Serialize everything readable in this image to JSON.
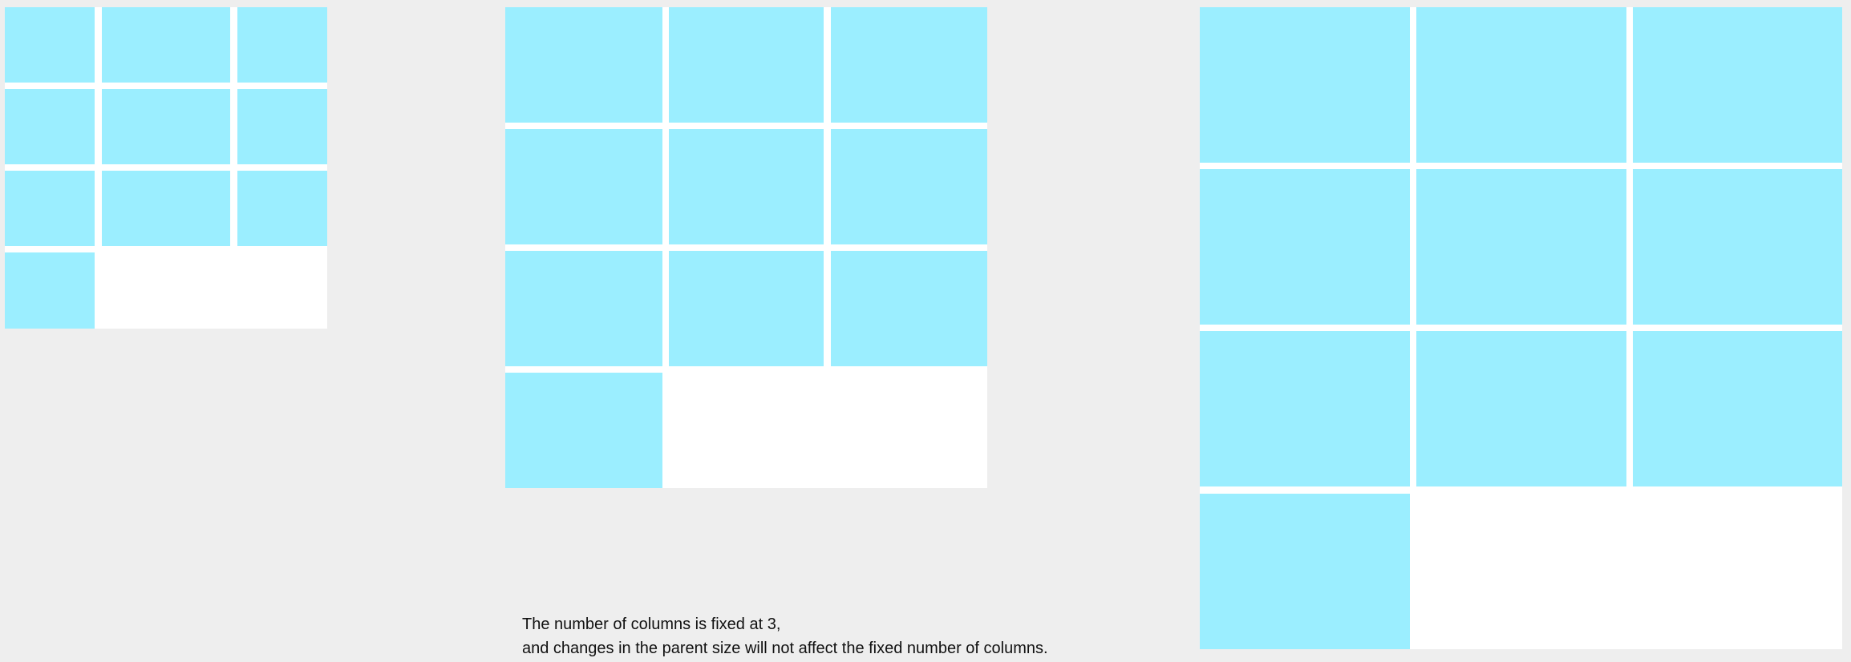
{
  "diagram": {
    "columns": 3,
    "item_count": 10,
    "colors": {
      "background": "#eeeeee",
      "container": "#ffffff",
      "item": "#9beeff",
      "text": "#111111"
    },
    "caption": {
      "line1": "The number of columns is fixed at 3,",
      "line2": "and changes in the parent size will not affect the fixed number of columns."
    }
  }
}
